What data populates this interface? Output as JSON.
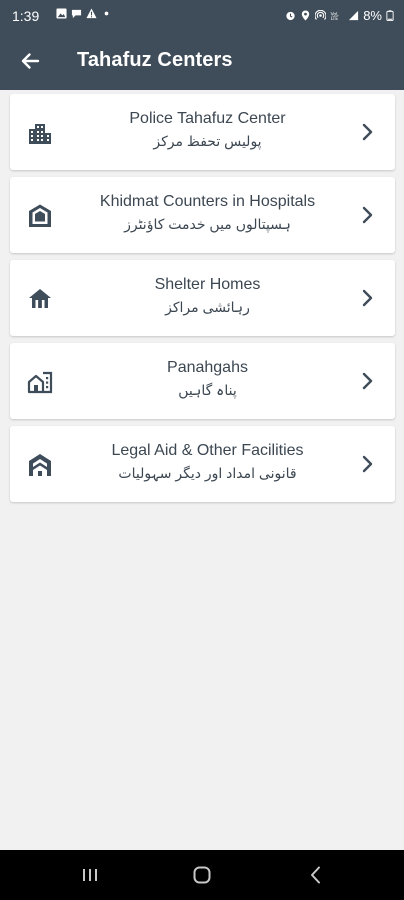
{
  "status_bar": {
    "time": "1:39",
    "battery": "8%",
    "left_icons": [
      "image-icon",
      "chat-icon",
      "alert-icon",
      "dot-icon"
    ],
    "right_icons": [
      "alarm-icon",
      "location-icon",
      "hotspot-icon",
      "volte-icon",
      "signal-icon",
      "battery-icon"
    ]
  },
  "app_bar": {
    "title": "Tahafuz Centers",
    "back_icon": "back-arrow-icon"
  },
  "items": [
    {
      "title": "Police Tahafuz Center",
      "subtitle": "پولیس تحفظ مرکز",
      "icon": "building-icon"
    },
    {
      "title": "Khidmat Counters in Hospitals",
      "subtitle": "ہسپتالوں میں خدمت کاؤنٹرز",
      "icon": "hospital-icon"
    },
    {
      "title": "Shelter Homes",
      "subtitle": "رہائشی مراکز",
      "icon": "home-icon"
    },
    {
      "title": "Panahgahs",
      "subtitle": "پناہ گاہیں",
      "icon": "panahgah-icon"
    },
    {
      "title": "Legal Aid & Other Facilities",
      "subtitle": "قانونی امداد اور دیگر سہولیات",
      "icon": "legal-aid-icon"
    }
  ],
  "nav_bar": {
    "buttons": [
      "recents-icon",
      "home-button-icon",
      "back-nav-icon"
    ]
  },
  "colors": {
    "primary": "#3f4c59",
    "background": "#f1f1f2",
    "card": "#ffffff",
    "text": "#3c4752"
  }
}
